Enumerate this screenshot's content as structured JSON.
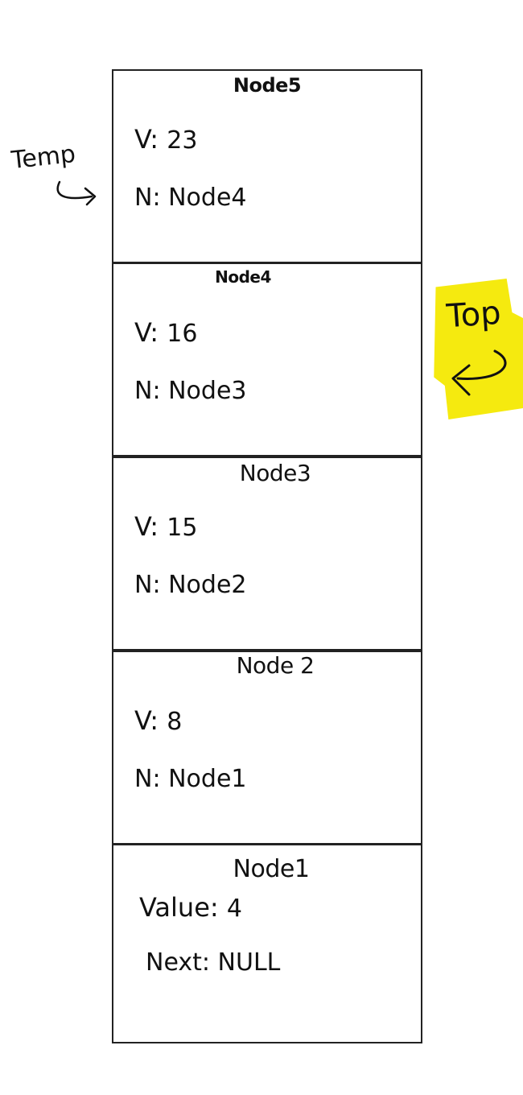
{
  "nodes": [
    {
      "title": "Node5",
      "value_label": "V:",
      "value": "23",
      "next_label": "N:",
      "next": "Node4"
    },
    {
      "title": "Node4",
      "value_label": "V:",
      "value": "16",
      "next_label": "N:",
      "next": "Node3"
    },
    {
      "title": "Node3",
      "value_label": "V:",
      "value": "15",
      "next_label": "N:",
      "next": "Node2"
    },
    {
      "title": "Node 2",
      "value_label": "V:",
      "value": "8",
      "next_label": "N:",
      "next": "Node1"
    },
    {
      "title": "Node1",
      "value_label": "Value:",
      "value": "4",
      "next_label": "Next:",
      "next": "NULL"
    }
  ],
  "pointers": {
    "temp": {
      "label": "Temp",
      "points_to": "Node5"
    },
    "top": {
      "label": "Top",
      "points_to": "Node4",
      "highlight_color": "#f5ea0f"
    }
  }
}
